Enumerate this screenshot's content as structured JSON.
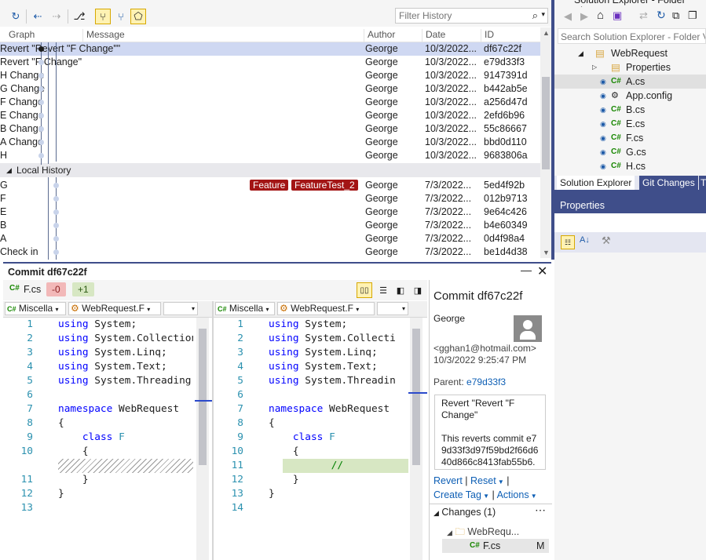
{
  "history": {
    "filter_placeholder": "Filter History",
    "columns": {
      "graph": "Graph",
      "message": "Message",
      "author": "Author",
      "date": "Date",
      "id": "ID"
    },
    "commits": [
      {
        "message": "Revert \"Revert \"F Change\"\"",
        "author": "George",
        "date": "10/3/2022...",
        "id": "df67c22f"
      },
      {
        "message": "Revert \"F Change\"",
        "author": "George",
        "date": "10/3/2022...",
        "id": "e79d33f3"
      },
      {
        "message": "H Change",
        "author": "George",
        "date": "10/3/2022...",
        "id": "9147391d"
      },
      {
        "message": "G Change",
        "author": "George",
        "date": "10/3/2022...",
        "id": "b442ab5e"
      },
      {
        "message": "F Change",
        "author": "George",
        "date": "10/3/2022...",
        "id": "a256d47d"
      },
      {
        "message": "E Change",
        "author": "George",
        "date": "10/3/2022...",
        "id": "2efd6b96"
      },
      {
        "message": "B Change",
        "author": "George",
        "date": "10/3/2022...",
        "id": "55c86667"
      },
      {
        "message": "A Change",
        "author": "George",
        "date": "10/3/2022...",
        "id": "bbd0d110"
      },
      {
        "message": "H",
        "author": "George",
        "date": "10/3/2022...",
        "id": "9683806a"
      }
    ],
    "local_section_label": "Local History",
    "local_commits": [
      {
        "message": "G",
        "author": "George",
        "date": "7/3/2022...",
        "id": "5ed4f92b"
      },
      {
        "message": "F",
        "author": "George",
        "date": "7/3/2022...",
        "id": "012b9713"
      },
      {
        "message": "E",
        "author": "George",
        "date": "7/3/2022...",
        "id": "9e64c426"
      },
      {
        "message": "B",
        "author": "George",
        "date": "7/3/2022...",
        "id": "b4e60349"
      },
      {
        "message": "A",
        "author": "George",
        "date": "7/3/2022...",
        "id": "0d4f98a4"
      },
      {
        "message": "Check in",
        "author": "George",
        "date": "7/3/2022...",
        "id": "be1d4d38"
      }
    ],
    "tags": [
      "Feature",
      "FeatureTest_2"
    ]
  },
  "commit": {
    "title": "Commit df67c22f",
    "file": "F.cs",
    "removed": "-0",
    "added": "+1",
    "nav_left": {
      "project": "Miscella",
      "member": "WebRequest.F"
    },
    "nav_right": {
      "project": "Miscella",
      "member": "WebRequest.F"
    },
    "left_lines": [
      {
        "n": "1",
        "text": "using System;"
      },
      {
        "n": "2",
        "text": "using System.Collection"
      },
      {
        "n": "3",
        "text": "using System.Linq;"
      },
      {
        "n": "4",
        "text": "using System.Text;"
      },
      {
        "n": "5",
        "text": "using System.Threading."
      },
      {
        "n": "6",
        "text": ""
      },
      {
        "n": "7",
        "text": "namespace WebRequest"
      },
      {
        "n": "8",
        "text": "{"
      },
      {
        "n": "9",
        "text": "    class F"
      },
      {
        "n": "10",
        "text": "    {"
      },
      {
        "n": "",
        "text": ""
      },
      {
        "n": "11",
        "text": "    }"
      },
      {
        "n": "12",
        "text": "}"
      },
      {
        "n": "13",
        "text": ""
      }
    ],
    "right_lines": [
      {
        "n": "1",
        "text": "using System;"
      },
      {
        "n": "2",
        "text": "using System.Collecti"
      },
      {
        "n": "3",
        "text": "using System.Linq;"
      },
      {
        "n": "4",
        "text": "using System.Text;"
      },
      {
        "n": "5",
        "text": "using System.Threadin"
      },
      {
        "n": "6",
        "text": ""
      },
      {
        "n": "7",
        "text": "namespace WebRequest"
      },
      {
        "n": "8",
        "text": "{"
      },
      {
        "n": "9",
        "text": "    class F"
      },
      {
        "n": "10",
        "text": "    {"
      },
      {
        "n": "11",
        "text": "        //"
      },
      {
        "n": "12",
        "text": "    }"
      },
      {
        "n": "13",
        "text": "}"
      },
      {
        "n": "14",
        "text": ""
      }
    ]
  },
  "details": {
    "title": "Commit df67c22f",
    "author": "George",
    "email": "<gghan1@hotmail.com>",
    "datetime": "10/3/2022 9:25:47 PM",
    "parent_label": "Parent:",
    "parent_id": "e79d33f3",
    "message_title": "Revert \"Revert \"F Change\"",
    "message_body": "This reverts commit e79d33f3d97f59bd2f66d640d866c8413fab55b6.",
    "revert": "Revert",
    "reset": "Reset",
    "create_tag": "Create Tag",
    "actions": "Actions",
    "changes_label": "Changes (1)",
    "folder": "WebRequ...",
    "changed_file": "F.cs",
    "changed_status": "M"
  },
  "solution_explorer": {
    "title": "Solution Explorer - Folder View",
    "search_placeholder": "Search Solution Explorer - Folder Vi",
    "project": "WebRequest",
    "items": [
      "Properties",
      "A.cs",
      "App.config",
      "B.cs",
      "E.cs",
      "F.cs",
      "G.cs",
      "H.cs"
    ],
    "tabs": [
      "Solution Explorer",
      "Git Changes",
      "T"
    ],
    "properties_label": "Properties"
  },
  "colors": {
    "accent": "#3f4e8a",
    "selection": "#cfd8f2",
    "tag": "#a31515",
    "added": "#d7e7c3",
    "removed": "#f2b8b8"
  }
}
